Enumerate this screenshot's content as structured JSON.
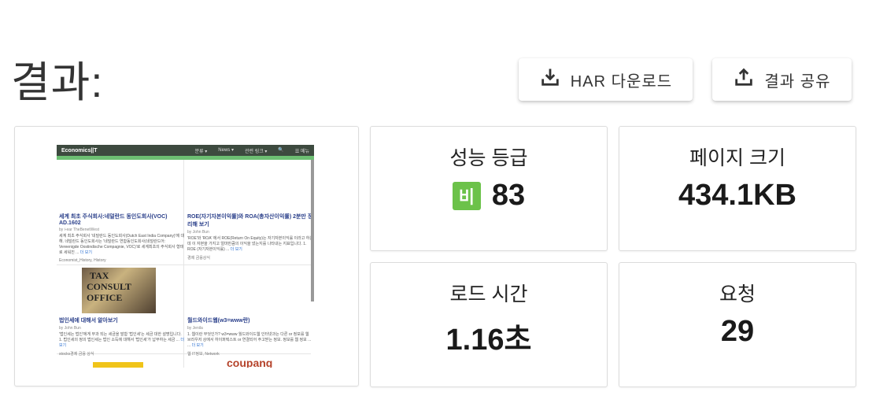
{
  "page": {
    "title": "결과:"
  },
  "actions": {
    "download_har": {
      "label": "HAR 다운로드",
      "icon": "download-icon"
    },
    "share_result": {
      "label": "결과 공유",
      "icon": "upload-share-icon"
    }
  },
  "metrics": {
    "grade": {
      "label": "성능 등급",
      "badge": "비",
      "value": "83",
      "badge_color": "#6cc24a"
    },
    "page_size": {
      "label": "페이지 크기",
      "value": "434.1KB"
    },
    "load_time": {
      "label": "로드 시간",
      "value": "1.16초"
    },
    "requests": {
      "label": "요청",
      "value": "29"
    }
  },
  "screenshot": {
    "site_name": "Economics||T",
    "nav": [
      "분류 ▾",
      "News ▾",
      "관련 링크 ▾",
      "🔍",
      "☰ 메뉴"
    ],
    "posts": [
      {
        "title": "세계 최초 주식회사:네덜란드 동인도회사(VOC) AD.1602",
        "author": "by i-ear TheBenetWest",
        "excerpt": "세계 최초 주식회사 '네덜란드 동인도회사(Dutch East India Company)'에 대해. 네덜란드 동인도회사는 '네덜란드 연합동인도회사(네덜란드어: Vereenigde Oostindische Compagnie, VOC)'로 세계최초의 주식회사 형태로 세워진",
        "more": "더 보기",
        "tags": "Economist_History, History"
      },
      {
        "title": "ROE(자기자본이익률)와 ROA(총자산이익률) 2분만 정리해 보기",
        "author": "by John Bun",
        "excerpt": "'ROE'와 'ROA' 에서 ROE(Return On Equity)는 자기자본이익률 이라고 하는 데 이 자본을 가지고 얼마만큼의 이익을 냈는지를 나타내는 지표입니다. 1. ROE (자기자본이익률)",
        "more": "더 보기",
        "tags": "경제 금융상식"
      },
      {
        "title": "법인세에 대해서 알아보기",
        "author": "by John Bun",
        "excerpt": "'법인세는 법인'에게 부과 되는 세금을 말함 '법인세'는 세금 대한 설명입니다. 1. 법인세의 정의 법인세는 법인 소득에 대해서 '법인세'가 납부하는 세금",
        "more": "더 보기",
        "tags": "stocks경제 금융 상식"
      },
      {
        "title": "월드와이드웹(w3=www란)",
        "author": "by Jenila",
        "excerpt": "1. 웹이란 무엇인가? w3=www 월드와이드웹 인터넷과는 다른 or 정보를 웹 브라우저 상에서 하이퍼텍스트 or 연결되어 주고받는 정보. 정보를 웹 정보 ...",
        "more": "더 보기",
        "tags": "웹 IT정보, Network"
      }
    ],
    "image_text": [
      "TAX",
      "CONSULT",
      "OFFICE"
    ],
    "ad_text": "coupang"
  }
}
